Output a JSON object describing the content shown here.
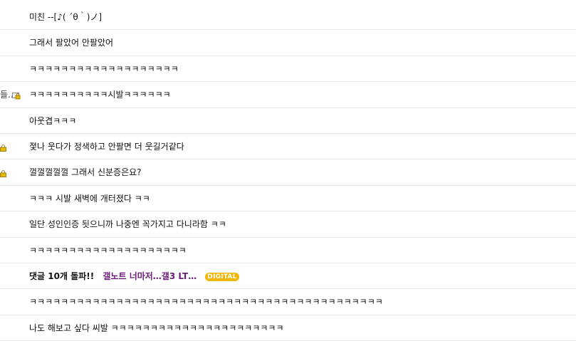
{
  "comments": [
    {
      "text": "미친 --[♪( ´θ｀)ノ]"
    },
    {
      "text": "그래서 팔았어 안팔았어"
    },
    {
      "text": "ㅋㅋㅋㅋㅋㅋㅋㅋㅋㅋㅋㅋㅋㅋㅋㅋㅋㅋㅋ"
    },
    {
      "text": "ㅋㅋㅋㅋㅋㅋㅋㅋㅋㅋ시발ㅋㅋㅋㅋㅋㅋ",
      "left_fragment": "들..",
      "left_icon": true
    },
    {
      "text": "아웃겹ㅋㅋㅋ"
    },
    {
      "text": "졏나 웃다가 정색하고 안팔면 더 웃길거같다",
      "left_icon": true
    },
    {
      "text": "껄껄껄껄껄 그래서 신분증은요?",
      "left_icon": true
    },
    {
      "text": "ㅋㅋㅋ 시발 새벽에 개터졌다 ㅋㅋ"
    },
    {
      "text": "일단 성인인증 됫으니까 나중엔 꼭가지고 다니라함 ㅋㅋ"
    },
    {
      "text": "ㅋㅋㅋㅋㅋㅋㅋㅋㅋㅋㅋㅋㅋㅋㅋㅋㅋㅋㅋㅋ"
    },
    {
      "text": "댓글 10개 돌파!!",
      "featured": true,
      "gallery_link": "갤노트 너마저…갤3 LT…",
      "badge": "DIGITAL"
    },
    {
      "text": "ㅋㅋㅋㅋㅋㅋㅋㅋㅋㅋㅋㅋㅋㅋㅋㅋㅋㅋㅋㅋㅋㅋㅋㅋㅋㅋㅋㅋㅋㅋㅋㅋㅋㅋㅋㅋㅋㅋㅋㅋㅋㅋㅋㅋㅋ"
    },
    {
      "text": "나도 해보고 싶다 씨발 ㅋㅋㅋㅋㅋㅋㅋㅋㅋㅋㅋㅋㅋㅋㅋㅋㅋㅋㅋㅋㅋㅋ"
    }
  ],
  "colors": {
    "divider": "#e7e7e7",
    "gallery_link": "#6a1b7a",
    "badge_bg": "#f1b600"
  },
  "icons": {
    "lock": "lock-icon"
  }
}
